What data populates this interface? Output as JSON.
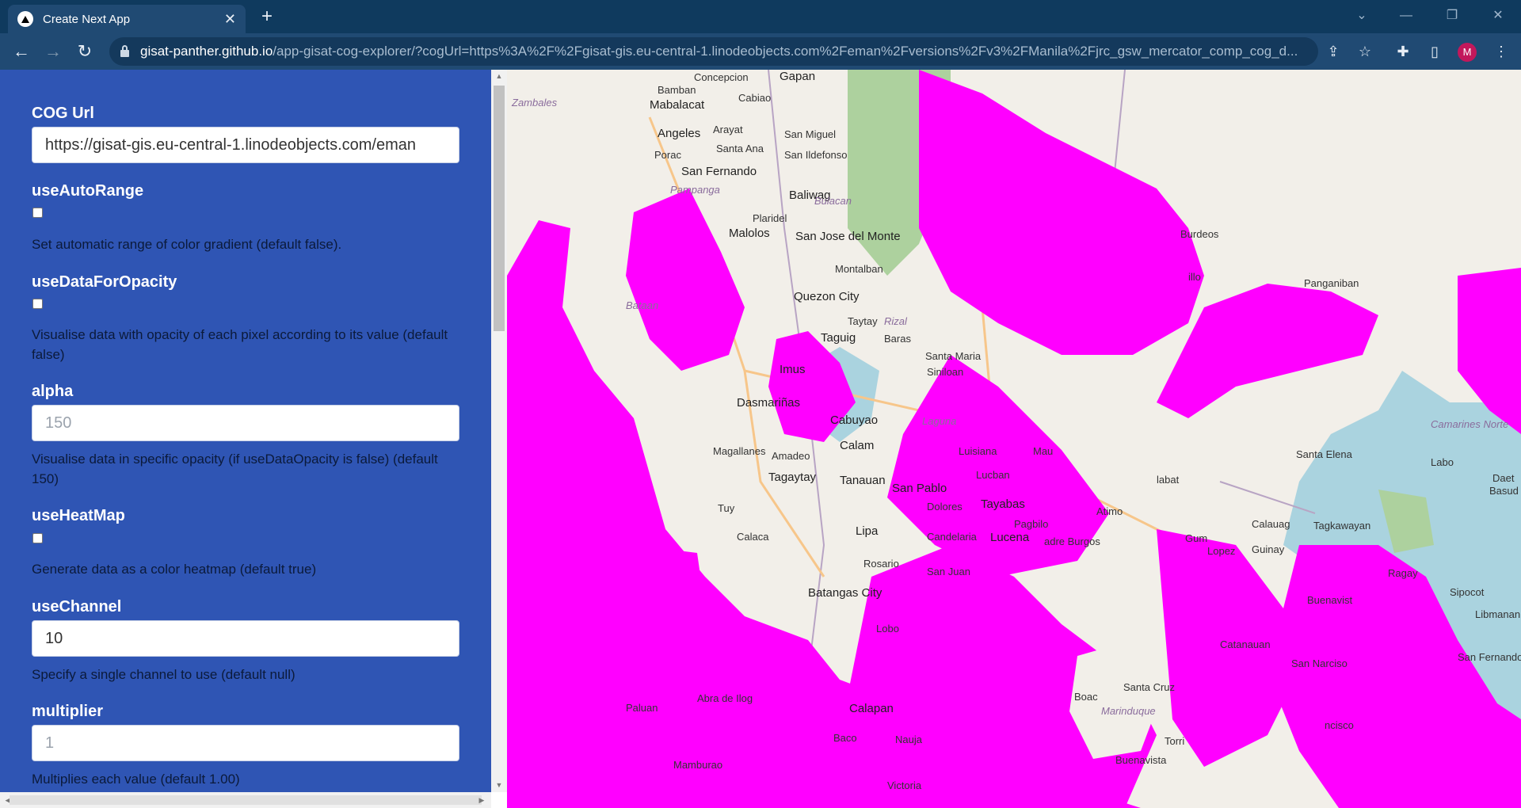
{
  "browser": {
    "tab_title": "Create Next App",
    "new_tab": "+",
    "url_host": "gisat-panther.github.io",
    "url_path": "/app-gisat-cog-explorer/?cogUrl=https%3A%2F%2Fgisat-gis.eu-central-1.linodeobjects.com%2Feman%2Fversions%2Fv3%2FManila%2Fjrc_gsw_mercator_comp_cog_d...",
    "profile_initial": "M"
  },
  "form": {
    "cog_url": {
      "label": "COG Url",
      "value": "https://gisat-gis.eu-central-1.linodeobjects.com/eman"
    },
    "use_auto_range": {
      "label": "useAutoRange",
      "checked": false,
      "hint": "Set automatic range of color gradient (default false)."
    },
    "use_data_for_opacity": {
      "label": "useDataForOpacity",
      "checked": false,
      "hint": "Visualise data with opacity of each pixel according to its value (default false)"
    },
    "alpha": {
      "label": "alpha",
      "placeholder": "150",
      "hint": "Visualise data in specific opacity (if useDataOpacity is false) (default 150)"
    },
    "use_heat_map": {
      "label": "useHeatMap",
      "checked": false,
      "hint": "Generate data as a color heatmap (default true)"
    },
    "use_channel": {
      "label": "useChannel",
      "value": "10",
      "hint": "Specify a single channel to use (default null)"
    },
    "multiplier": {
      "label": "multiplier",
      "placeholder": "1",
      "hint": "Multiplies each value (default 1.00)"
    }
  },
  "map": {
    "overlay_color": "#ff00ff",
    "places": {
      "concepcion": "Concepcion",
      "gapan": "Gapan",
      "tambales": "Zambales",
      "bamban": "Bamban",
      "mabalacat": "Mabalacat",
      "cabiao": "Cabiao",
      "angeles": "Angeles",
      "arayat": "Arayat",
      "san_miguel": "San Miguel",
      "porac": "Porac",
      "santa_ana": "Santa Ana",
      "san_ildefonso": "San Ildefonso",
      "san_fernando": "San Fernando",
      "pampanga": "Pampanga",
      "baliwag": "Baliwag",
      "bulacan": "Bulacan",
      "plaridel": "Plaridel",
      "malolos": "Malolos",
      "san_jose_del_monte": "San Jose del Monte",
      "montalban": "Montalban",
      "quezon_city": "Quezon City",
      "taytay": "Taytay",
      "rizal": "Rizal",
      "taguig": "Taguig",
      "baras": "Baras",
      "santa_maria": "Santa Maria",
      "siniloan": "Siniloan",
      "imus": "Imus",
      "dasmarinas": "Dasmariñas",
      "cabuyao": "Cabuyao",
      "laguna": "Laguna",
      "calamba": "Calam",
      "luisiana": "Luisiana",
      "magallanes": "Magallanes",
      "amadeo": "Amadeo",
      "tagaytay": "Tagaytay",
      "tanauan": "Tanauan",
      "san_pablo": "San Pablo",
      "dolores": "Dolores",
      "tayabas": "Tayabas",
      "lucban": "Lucban",
      "lipa": "Lipa",
      "candelaria": "Candelaria",
      "lucena": "Lucena",
      "rosario": "Rosario",
      "batangas_city": "Batangas City",
      "calaca": "Calaca",
      "tuy": "Tuy",
      "lobo": "Lobo",
      "san_juan": "San Juan",
      "bataan": "Bataan",
      "abra_de_ilog": "Abra de Ilog",
      "paluan": "Paluan",
      "calapan": "Calapan",
      "baco": "Baco",
      "naujan": "Nauja",
      "victoria": "Victoria",
      "mamburao": "Mamburao",
      "boac": "Boac",
      "santa_cruz": "Santa Cruz",
      "marinduque": "Marinduque",
      "buenavista": "Buenavista",
      "torrijos": "Torri",
      "camarines_norte": "Camarines Norte",
      "labo": "Labo",
      "daet": "Daet",
      "basud": "Basud",
      "santa_elena": "Santa Elena",
      "tagkawayan": "Tagkawayan",
      "lopez": "Lopez",
      "guinayangan": "Guinay",
      "ragay": "Ragay",
      "sipocot": "Sipocot",
      "libmanan": "Libmanan",
      "buenavista_q": "Buenavist",
      "san_fernando_cs": "San Fernando",
      "mauban": "Mau",
      "catanauan": "Catanauan",
      "san_narciso": "San Narciso",
      "francisco": "ncisco",
      "atimonan": "Atimo",
      "burdeos": "Burdeos",
      "alabat": "labat",
      "gumaca": "Gum",
      "calauag": "Calauag",
      "pagbilao": "Pagbilo",
      "padre_burgos": "adre Burgos",
      "polillo": "illo",
      "panganiban": "Panganiban"
    }
  }
}
